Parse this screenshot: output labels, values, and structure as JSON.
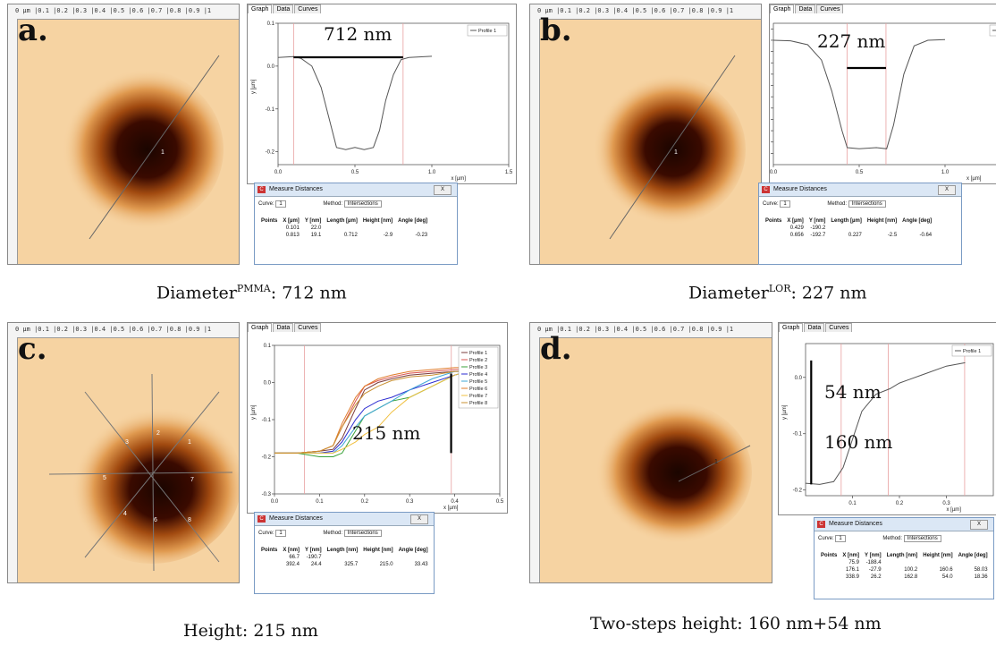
{
  "ruler_top": "0 µm |0.1 |0.2 |0.3 |0.4 |0.5 |0.6 |0.7 |0.8 |0.9 |1",
  "tabs": [
    "Graph",
    "Data",
    "Curves"
  ],
  "measure": {
    "title": "Measure Distances",
    "curve_label": "Curve:",
    "curve_value": "1",
    "method_label": "Method:",
    "method_value": "Intersections",
    "close_label": "X"
  },
  "panels": {
    "a": {
      "letter": "a.",
      "annotation": "712 nm",
      "legend": "Profile 1",
      "xlabel": "x [µm]",
      "ylabel": "y [µm]",
      "table_headers": [
        "Points",
        "X [µm]",
        "Y [nm]",
        "Length [µm]",
        "Height [nm]",
        "Angle [deg]"
      ],
      "table_rows": [
        [
          "",
          "0.101",
          "22.0",
          "",
          "",
          ""
        ],
        [
          "",
          "0.813",
          "19.1",
          "0.712",
          "-2.9",
          "-0.23"
        ]
      ],
      "caption_main": "Diameter",
      "caption_sup": "PMMA",
      "caption_rest": ": 712 nm"
    },
    "b": {
      "letter": "b.",
      "annotation": "227 nm",
      "legend": "Profile 1",
      "xlabel": "x [µm]",
      "table_headers": [
        "Points",
        "X [µm]",
        "Y [nm]",
        "Length [µm]",
        "Height [nm]",
        "Angle [deg]"
      ],
      "table_rows": [
        [
          "",
          "0.429",
          "-190.2",
          "",
          "",
          ""
        ],
        [
          "",
          "0.656",
          "-192.7",
          "0.227",
          "-2.5",
          "-0.64"
        ]
      ],
      "caption_main": "Diameter",
      "caption_sup": "LOR",
      "caption_rest": ": 227 nm"
    },
    "c": {
      "letter": "c.",
      "annotation": "215 nm",
      "xlabel": "x [µm]",
      "ylabel": "y [µm]",
      "table_headers": [
        "Points",
        "X [nm]",
        "Y [nm]",
        "Length [nm]",
        "Height [nm]",
        "Angle [deg]"
      ],
      "table_rows": [
        [
          "",
          "66.7",
          "-190.7",
          "",
          "",
          ""
        ],
        [
          "",
          "392.4",
          "24.4",
          "325.7",
          "215.0",
          "33.43"
        ]
      ],
      "caption": "Height:  215 nm"
    },
    "d": {
      "letter": "d.",
      "annotation_top": "54 nm",
      "annotation_bottom": "160 nm",
      "legend": "Profile 1",
      "xlabel": "x [µm]",
      "ylabel": "y [µm]",
      "table_headers": [
        "Points",
        "X [nm]",
        "Y [nm]",
        "Length [nm]",
        "Height [nm]",
        "Angle [deg]"
      ],
      "table_rows": [
        [
          "",
          "75.9",
          "-188.4",
          "",
          "",
          ""
        ],
        [
          "",
          "176.1",
          "-27.9",
          "100.2",
          "160.6",
          "58.03"
        ],
        [
          "",
          "338.9",
          "26.2",
          "162.8",
          "54.0",
          "18.36"
        ]
      ],
      "caption": "Two-steps height: 160 nm+54 nm"
    }
  },
  "chart_data": [
    {
      "type": "line",
      "panel": "a",
      "xlim": [
        0,
        1.5
      ],
      "ylim": [
        -0.23,
        0.1
      ],
      "xticks": [
        0.0,
        0.5,
        1.0,
        1.5
      ],
      "yticks": [
        0.1,
        0.0,
        -0.1,
        -0.2
      ],
      "series": [
        {
          "name": "Profile 1",
          "x": [
            0.0,
            0.1,
            0.15,
            0.22,
            0.28,
            0.33,
            0.38,
            0.44,
            0.5,
            0.56,
            0.62,
            0.66,
            0.7,
            0.75,
            0.8,
            0.85,
            1.0
          ],
          "y": [
            0.02,
            0.022,
            0.018,
            0.0,
            -0.05,
            -0.12,
            -0.19,
            -0.195,
            -0.19,
            -0.195,
            -0.19,
            -0.15,
            -0.08,
            -0.02,
            0.015,
            0.02,
            0.023
          ]
        }
      ],
      "markers_x": [
        0.101,
        0.813
      ]
    },
    {
      "type": "line",
      "panel": "b",
      "xlim": [
        0,
        1.5
      ],
      "ylim": [
        -220,
        30
      ],
      "xticks": [
        0.0,
        0.5,
        1.0,
        1.5
      ],
      "yticks": [
        20.0,
        0.0,
        -20.0,
        -40.0,
        -60.0,
        -80.0,
        -100.0,
        -120.0,
        -140.0,
        -160.0,
        -180.0,
        -200.0
      ],
      "series": [
        {
          "name": "Profile 1",
          "x": [
            0.0,
            0.1,
            0.2,
            0.28,
            0.34,
            0.4,
            0.43,
            0.5,
            0.6,
            0.66,
            0.7,
            0.76,
            0.82,
            0.9,
            1.0
          ],
          "y": [
            0,
            -1,
            -8,
            -35,
            -90,
            -160,
            -190,
            -192,
            -190,
            -192,
            -150,
            -60,
            -10,
            0,
            1
          ]
        }
      ],
      "markers_x": [
        0.429,
        0.656
      ]
    },
    {
      "type": "line",
      "panel": "c",
      "xlim": [
        0,
        0.5
      ],
      "ylim": [
        -0.3,
        0.1
      ],
      "xticks": [
        0.0,
        0.1,
        0.2,
        0.3,
        0.4,
        0.5
      ],
      "yticks": [
        0.1,
        0.0,
        -0.1,
        -0.2,
        -0.3
      ],
      "x": [
        0.0,
        0.05,
        0.1,
        0.13,
        0.15,
        0.18,
        0.2,
        0.23,
        0.26,
        0.3,
        0.35,
        0.4,
        0.43
      ],
      "series": [
        {
          "name": "Profile 1",
          "color": "#7a3b3b",
          "y": [
            -0.19,
            -0.19,
            -0.185,
            -0.18,
            -0.15,
            -0.07,
            -0.02,
            0.0,
            0.01,
            0.02,
            0.025,
            0.03,
            0.03
          ]
        },
        {
          "name": "Profile 2",
          "color": "#d9534f",
          "y": [
            -0.19,
            -0.19,
            -0.185,
            -0.17,
            -0.12,
            -0.05,
            -0.01,
            0.005,
            0.015,
            0.025,
            0.03,
            0.035,
            0.035
          ]
        },
        {
          "name": "Profile 3",
          "color": "#3aa23a",
          "y": [
            -0.19,
            -0.19,
            -0.2,
            -0.2,
            -0.19,
            -0.13,
            -0.09,
            -0.07,
            -0.05,
            -0.04,
            -0.01,
            0.02,
            0.03
          ]
        },
        {
          "name": "Profile 4",
          "color": "#2a2ad0",
          "y": [
            -0.19,
            -0.19,
            -0.19,
            -0.185,
            -0.16,
            -0.1,
            -0.07,
            -0.05,
            -0.04,
            -0.02,
            0.0,
            0.02,
            0.03
          ]
        },
        {
          "name": "Profile 5",
          "color": "#3fa7d6",
          "y": [
            -0.19,
            -0.19,
            -0.19,
            -0.19,
            -0.17,
            -0.12,
            -0.09,
            -0.07,
            -0.05,
            -0.02,
            0.01,
            0.03,
            0.03
          ]
        },
        {
          "name": "Profile 6",
          "color": "#e07b2a",
          "y": [
            -0.19,
            -0.19,
            -0.185,
            -0.17,
            -0.11,
            -0.04,
            -0.01,
            0.01,
            0.02,
            0.03,
            0.035,
            0.04,
            0.04
          ]
        },
        {
          "name": "Profile 7",
          "color": "#f0c040",
          "y": [
            -0.19,
            -0.19,
            -0.19,
            -0.19,
            -0.18,
            -0.16,
            -0.14,
            -0.12,
            -0.08,
            -0.04,
            -0.01,
            0.02,
            0.03
          ]
        },
        {
          "name": "Profile 8",
          "color": "#c99030",
          "y": [
            -0.19,
            -0.19,
            -0.185,
            -0.17,
            -0.12,
            -0.06,
            -0.03,
            -0.01,
            0.005,
            0.015,
            0.02,
            0.03,
            0.03
          ]
        }
      ],
      "markers_x": [
        0.0667,
        0.3924
      ]
    },
    {
      "type": "line",
      "panel": "d",
      "xlim": [
        0,
        0.4
      ],
      "ylim": [
        -0.21,
        0.06
      ],
      "xticks": [
        0.1,
        0.2,
        0.3
      ],
      "yticks": [
        0.0,
        -0.1,
        -0.2
      ],
      "series": [
        {
          "name": "Profile 1",
          "x": [
            0.0,
            0.03,
            0.06,
            0.08,
            0.1,
            0.12,
            0.15,
            0.18,
            0.2,
            0.25,
            0.3,
            0.34
          ],
          "y": [
            -0.188,
            -0.19,
            -0.185,
            -0.16,
            -0.11,
            -0.06,
            -0.03,
            -0.02,
            -0.01,
            0.005,
            0.02,
            0.026
          ]
        }
      ],
      "markers_x": [
        0.0759,
        0.1761,
        0.3389
      ]
    }
  ]
}
